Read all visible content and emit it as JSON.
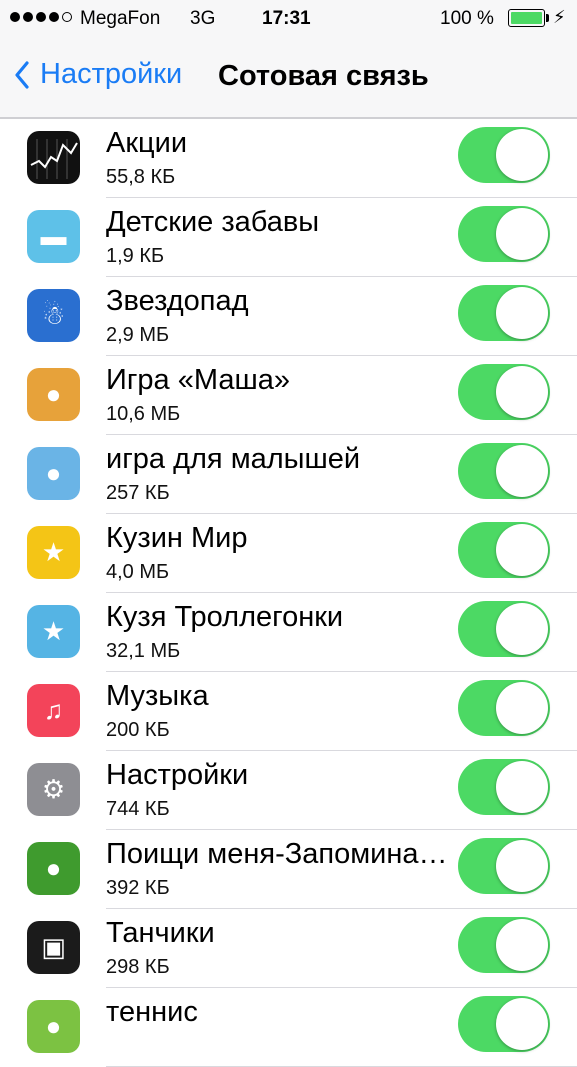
{
  "status": {
    "carrier": "MegaFon",
    "network": "3G",
    "time": "17:31",
    "battery": "100 %"
  },
  "nav": {
    "back_label": "Настройки",
    "title": "Сотовая связь"
  },
  "apps": [
    {
      "name": "Акции",
      "size": "55,8 КБ",
      "icon": "stocks-icon",
      "color": "#111111",
      "enabled": true
    },
    {
      "name": "Детские забавы",
      "size": "1,9 КБ",
      "icon": "kids-car-icon",
      "color": "#5ec1e8",
      "enabled": true
    },
    {
      "name": "Звездопад",
      "size": "2,9 МБ",
      "icon": "snowman-icon",
      "color": "#2a6fd0",
      "enabled": true
    },
    {
      "name": "Игра «Маша»",
      "size": "10,6 МБ",
      "icon": "masha-icon",
      "color": "#e7a23a",
      "enabled": true
    },
    {
      "name": "игра для малышей",
      "size": "257 КБ",
      "icon": "monkey-icon",
      "color": "#6ab4e6",
      "enabled": true
    },
    {
      "name": "Кузин Мир",
      "size": "4,0 МБ",
      "icon": "kuzya-world-icon",
      "color": "#f4c516",
      "enabled": true
    },
    {
      "name": "Кузя Троллегонки",
      "size": "32,1 МБ",
      "icon": "kuzya-race-icon",
      "color": "#55b4e4",
      "enabled": true
    },
    {
      "name": "Музыка",
      "size": "200 КБ",
      "icon": "music-icon",
      "color": "#f3445a",
      "enabled": true
    },
    {
      "name": "Настройки",
      "size": "744 КБ",
      "icon": "settings-icon",
      "color": "#8e8e93",
      "enabled": true
    },
    {
      "name": "Поищи меня-Запоминалка",
      "size": "392 КБ",
      "icon": "ladybug-icon",
      "color": "#3f9b2e",
      "enabled": true
    },
    {
      "name": "Танчики",
      "size": "298 КБ",
      "icon": "tank-icon",
      "color": "#1b1b1b",
      "enabled": true
    },
    {
      "name": "теннис",
      "size": "",
      "icon": "tennis-icon",
      "color": "#7cc242",
      "enabled": true
    }
  ]
}
